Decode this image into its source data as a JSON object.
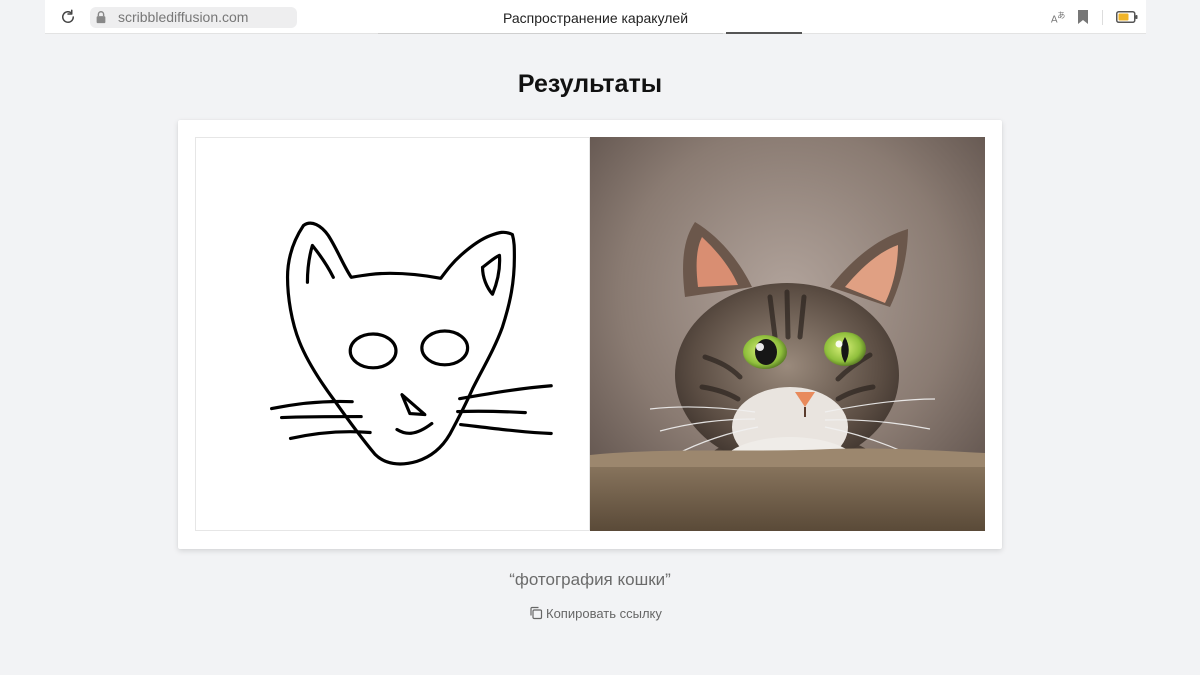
{
  "browser": {
    "url": "scribblediffusion.com",
    "tab_title": "Распространение каракулей"
  },
  "page": {
    "heading": "Результаты",
    "prompt": "“фотография кошки”",
    "copy_link_label": "Копировать ссылку"
  },
  "icons": {
    "reload": "reload-icon",
    "lock": "lock-icon",
    "translate": "translate-icon",
    "bookmark": "bookmark-icon",
    "battery": "battery-icon",
    "copy": "copy-icon"
  },
  "colors": {
    "page_background": "#f2f3f5",
    "card_background": "#ffffff",
    "scribble_stroke": "#000000",
    "battery_fill": "#f0b429"
  }
}
